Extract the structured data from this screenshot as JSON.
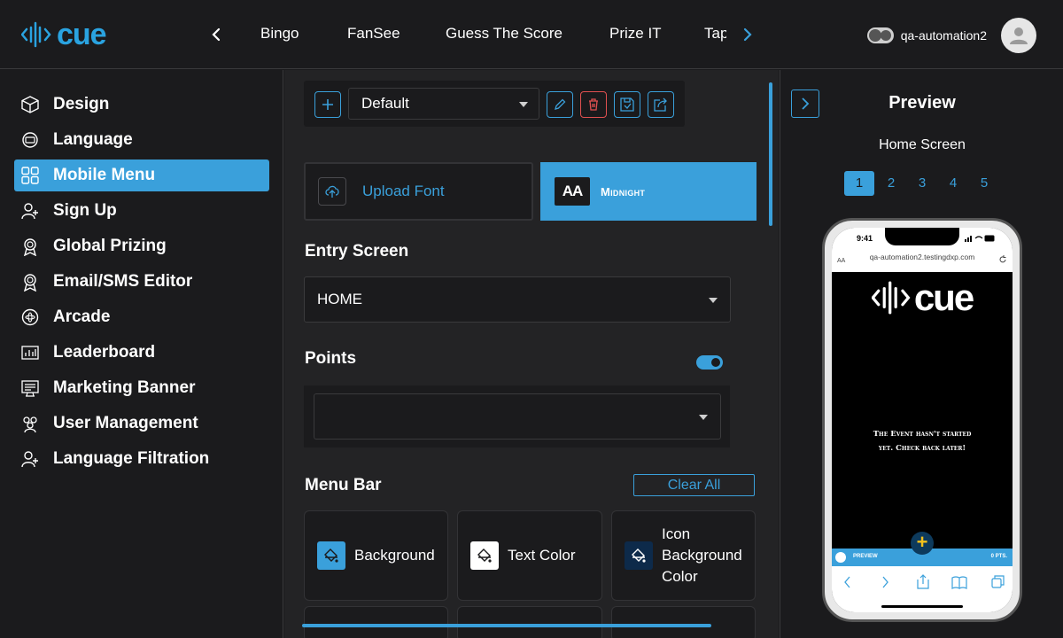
{
  "header": {
    "logo_text": "cue",
    "tabs": [
      {
        "label": "Bingo"
      },
      {
        "label": "FanSee"
      },
      {
        "label": "Guess The Score"
      },
      {
        "label": "Prize IT"
      },
      {
        "label": "Tap"
      }
    ],
    "username": "qa-automation2"
  },
  "sidebar": {
    "items": [
      {
        "label": "Design",
        "icon": "cube-icon"
      },
      {
        "label": "Language",
        "icon": "language-icon"
      },
      {
        "label": "Mobile Menu",
        "icon": "grid-icon",
        "active": true
      },
      {
        "label": "Sign Up",
        "icon": "user-add-icon"
      },
      {
        "label": "Global Prizing",
        "icon": "award-icon"
      },
      {
        "label": "Email/SMS Editor",
        "icon": "award-icon"
      },
      {
        "label": "Arcade",
        "icon": "atom-icon"
      },
      {
        "label": "Leaderboard",
        "icon": "leaderboard-icon"
      },
      {
        "label": "Marketing Banner",
        "icon": "banner-icon"
      },
      {
        "label": "User Management",
        "icon": "users-icon"
      },
      {
        "label": "Language Filtration",
        "icon": "user-add-icon"
      }
    ]
  },
  "main": {
    "theme_select": {
      "value": "Default"
    },
    "font": {
      "upload_label": "Upload Font",
      "selected_preview": "AA",
      "selected_name": "Midnight"
    },
    "entry_screen": {
      "title": "Entry Screen",
      "value": "HOME"
    },
    "points": {
      "title": "Points",
      "enabled": true,
      "value": ""
    },
    "menu_bar": {
      "title": "Menu Bar",
      "clear_label": "Clear All",
      "colors": [
        {
          "label": "Background",
          "swatch": "#3aa0db"
        },
        {
          "label": "Text Color",
          "swatch": "#ffffff"
        },
        {
          "label": "Icon Background Color",
          "swatch": "#0d2a4a"
        }
      ]
    }
  },
  "preview": {
    "title": "Preview",
    "screen_name": "Home Screen",
    "pages": [
      "1",
      "2",
      "3",
      "4",
      "5"
    ],
    "active_page": "1",
    "phone": {
      "time": "9:41",
      "url_aa": "AA",
      "url": "qa-automation2.testingdxp.com",
      "logo_text": "cue",
      "message": "The Event hasn't started yet. Check back later!",
      "bottom_label": "PREVIEW",
      "points_label": "0 PTS."
    }
  },
  "colors": {
    "accent": "#3aa0db",
    "background": "#1b1b1d",
    "panel": "#232325",
    "danger": "#e05050"
  }
}
